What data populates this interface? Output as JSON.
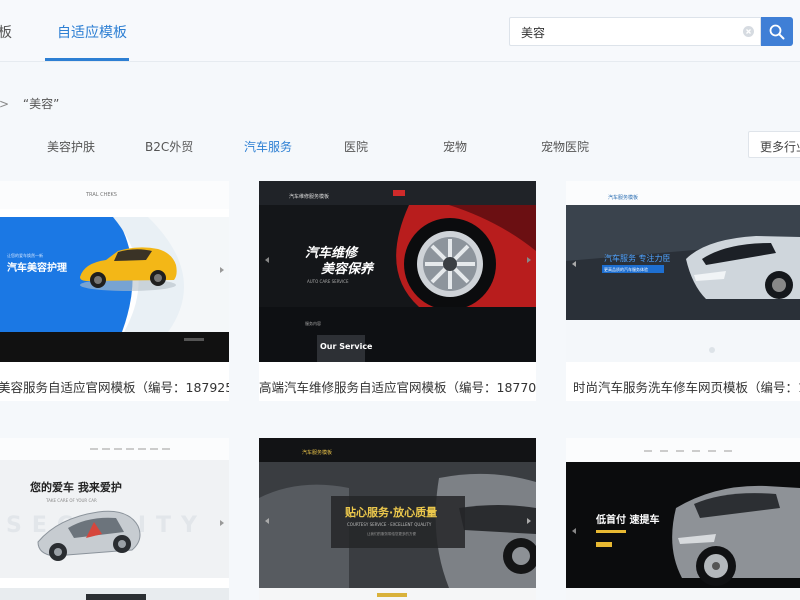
{
  "header": {
    "prev_tab": "板",
    "active_tab": "自适应模板",
    "search": {
      "value": "美容"
    }
  },
  "breadcrumb": {
    "separator": ">",
    "current": "“美容”"
  },
  "categories": [
    "美容护肤",
    "B2C外贸",
    "汽车服务",
    "医院",
    "宠物",
    "宠物医院"
  ],
  "active_category": "汽车服务",
  "more_button": "更多行业",
  "cards": [
    {
      "title": "美容服务自适应官网模板（编号：187925）",
      "thumb": {
        "logo": "TRAL CHEKS",
        "tag": "让您的爱车焕然一新",
        "headline": "汽车美容护理"
      }
    },
    {
      "title": "高端汽车维修服务自适应官网模板（编号：187709）",
      "thumb": {
        "brand": "汽车维修服务模板",
        "headline_line1": "汽车维修",
        "headline_line2": "美容保养",
        "sub": "AUTO CARE SERVICE",
        "section": "Our Service",
        "section_label": "服务内容"
      }
    },
    {
      "title": "时尚汽车服务洗车修车网页模板（编号：17",
      "thumb": {
        "brand": "汽车服务模板",
        "headline": "汽车服务 专注力臣",
        "tag": "更高品质的汽车服务体验"
      }
    },
    {
      "title": "",
      "thumb": {
        "headline": "您的爱车  我来爱护",
        "sub": "TAKE CARE OF YOUR CAR",
        "watermark": "SECURITY"
      }
    },
    {
      "title": "",
      "thumb": {
        "brand": "汽车服务模板",
        "headline": "贴心服务·放心质量",
        "sub": "COURTESY SERVICE · EXCELLENT QUALITY",
        "small": "让我们的服务带给您更多的方便"
      }
    },
    {
      "title": "",
      "thumb": {
        "headline": "低首付 速提车"
      }
    }
  ],
  "colors": {
    "accent": "#2d7fd3",
    "search_button": "#3f7fd6",
    "page_bg": "#f5f8fb"
  }
}
